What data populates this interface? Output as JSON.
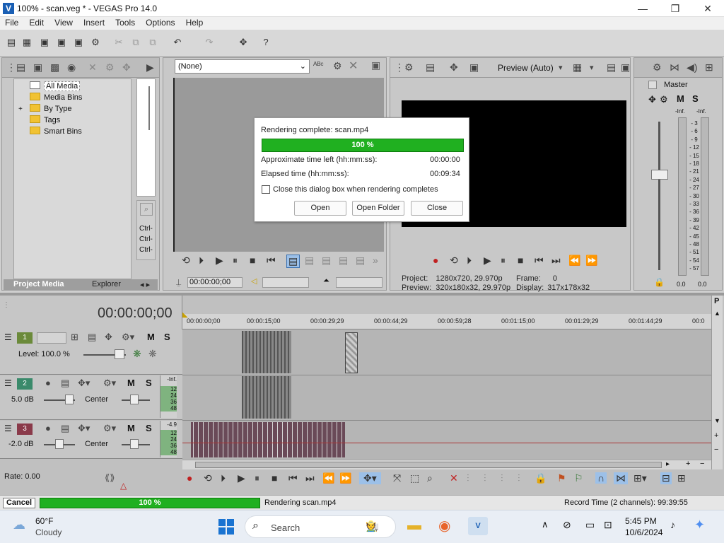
{
  "window": {
    "title": "100% - scan.veg * - VEGAS Pro 14.0",
    "logo": "V",
    "min": "—",
    "max": "❐",
    "close": "✕"
  },
  "menu": [
    "File",
    "Edit",
    "View",
    "Insert",
    "Tools",
    "Options",
    "Help"
  ],
  "toolbar_icons": {
    "new": "▤",
    "open": "▦",
    "save": "▣",
    "saveas": "▣",
    "render": "▣",
    "props": "⚙",
    "cut": "✂",
    "copy": "⧉",
    "paste": "⧉",
    "undo": "↶",
    "redo": "↷",
    "events": "✥",
    "help": "?"
  },
  "project_media": {
    "tree": [
      "All Media",
      "Media Bins",
      "By Type",
      "Tags",
      "Smart Bins"
    ],
    "expander": "+",
    "shortcuts": [
      "Ctrl-",
      "Ctrl-",
      "Ctrl-"
    ],
    "tabs": [
      "Project Media",
      "Explorer"
    ]
  },
  "trimmer": {
    "dropdown": "(None)",
    "timecode": "00:00:00;00"
  },
  "preview": {
    "mode": "Preview (Auto)",
    "project_label": "Project:",
    "project_value": "1280x720, 29.970p",
    "preview_label": "Preview:",
    "preview_value": "320x180x32, 29.970p",
    "frame_label": "Frame:",
    "frame_value": "0",
    "display_label": "Display:",
    "display_value": "317x178x32"
  },
  "dialog": {
    "title": "Rendering complete: scan.mp4",
    "progress_text": "100 %",
    "progress_value": 100,
    "time_left_label": "Approximate time left (hh:mm:ss):",
    "time_left_value": "00:00:00",
    "elapsed_label": "Elapsed time (hh:mm:ss):",
    "elapsed_value": "00:09:34",
    "checkbox_label": "Close this dialog box when rendering completes",
    "btn_open": "Open",
    "btn_open_folder": "Open Folder",
    "btn_close": "Close"
  },
  "master": {
    "label": "Master",
    "m": "M",
    "s": "S",
    "inf_left": "-Inf.",
    "inf_right": "-Inf.",
    "scale": [
      "3",
      "6",
      "9",
      "12",
      "15",
      "18",
      "21",
      "24",
      "27",
      "30",
      "33",
      "36",
      "39",
      "42",
      "45",
      "48",
      "51",
      "54",
      "57"
    ],
    "value_left": "0.0",
    "value_right": "0.0"
  },
  "timeline": {
    "timecode": "00:00:00;00",
    "ruler": [
      "00:00:00;00",
      "00:00:15;00",
      "00:00:29;29",
      "00:00:44;29",
      "00:00:59;28",
      "00:01:15;00",
      "00:01:29;29",
      "00:01:44;29",
      "00:0"
    ],
    "tracks": [
      {
        "num": "1",
        "color": "#6b8a3a",
        "level": "Level: 100.0 %",
        "m": "M",
        "s": "S"
      },
      {
        "num": "2",
        "color": "#3a8a6b",
        "vol": "5.0 dB",
        "pan": "Center",
        "m": "M",
        "s": "S",
        "meter": [
          "-Inf.",
          "12",
          "24",
          "36",
          "48"
        ]
      },
      {
        "num": "3",
        "color": "#8a3a4a",
        "vol": "-2.0 dB",
        "pan": "Center",
        "m": "M",
        "s": "S",
        "meter": [
          "-4.9",
          "12",
          "24",
          "36",
          "48"
        ]
      }
    ],
    "rate": "Rate: 0.00"
  },
  "status": {
    "cancel": "Cancel",
    "progress": "100 %",
    "progress_value": 100,
    "message": "Rendering scan.mp4",
    "record_time": "Record Time (2 channels): 99:39:55"
  },
  "taskbar": {
    "temp": "60°F",
    "weather": "Cloudy",
    "search": "Search",
    "time": "5:45 PM",
    "date": "10/6/2024"
  }
}
